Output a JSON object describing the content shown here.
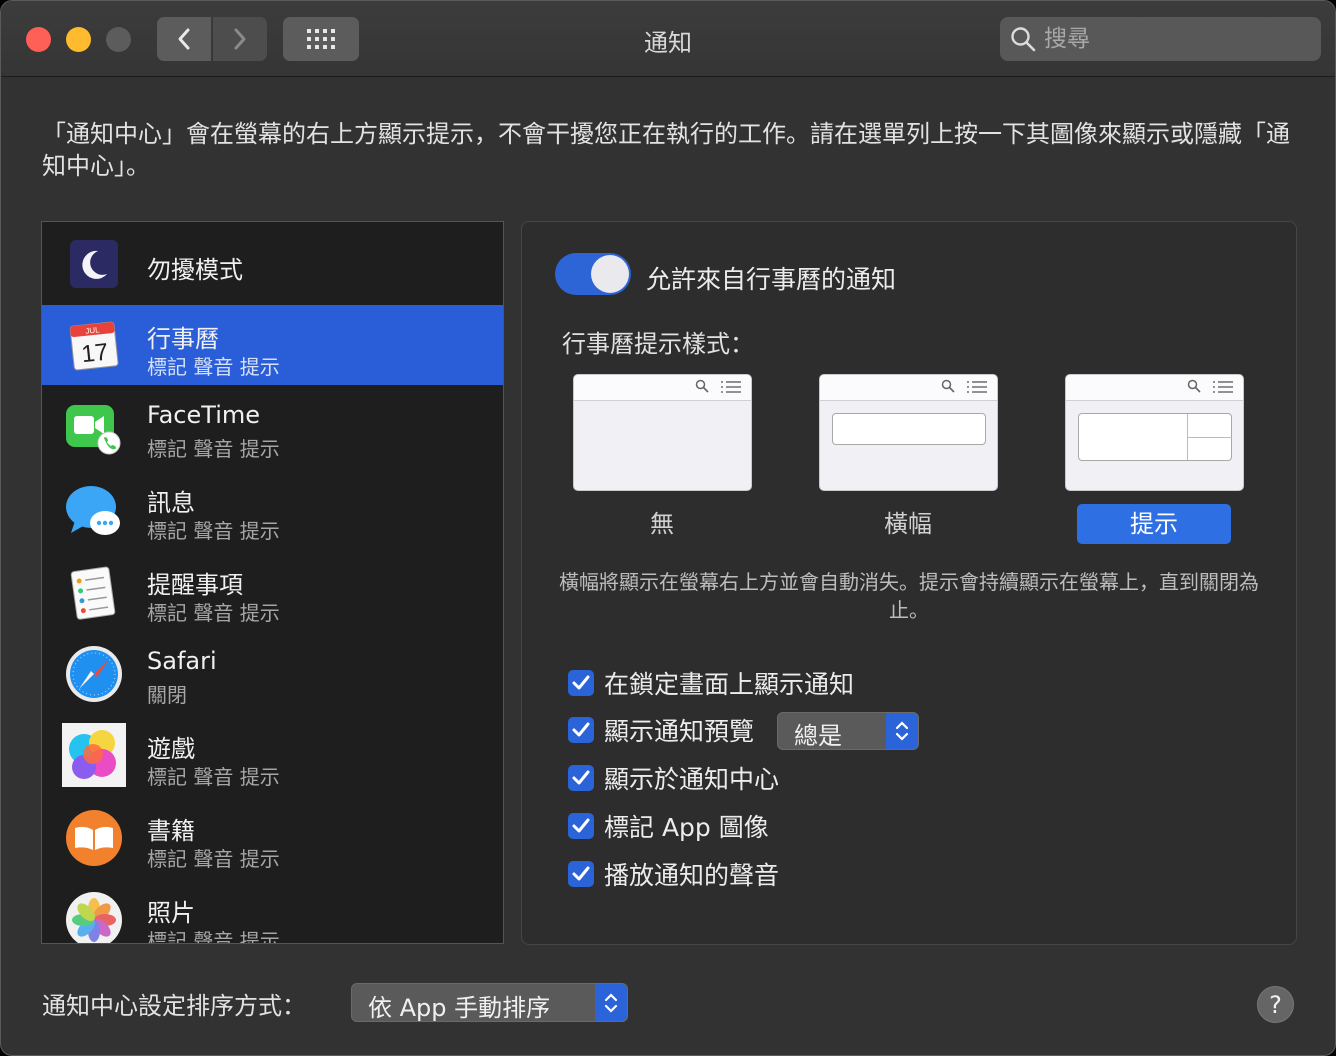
{
  "titlebar": {
    "title": "通知",
    "search_placeholder": "搜尋"
  },
  "description": "「通知中心」會在螢幕的右上方顯示提示，不會干擾您正在執行的工作。請在選單列上按一下其圖像來顯示或隱藏「通知中心」。",
  "apps": [
    {
      "name": "勿擾模式",
      "sub": ""
    },
    {
      "name": "行事曆",
      "sub": "標記 聲音 提示",
      "calendar_month": "JUL",
      "calendar_day": "17"
    },
    {
      "name": "FaceTime",
      "sub": "標記 聲音 提示"
    },
    {
      "name": "訊息",
      "sub": "標記 聲音 提示"
    },
    {
      "name": "提醒事項",
      "sub": "標記 聲音 提示"
    },
    {
      "name": "Safari",
      "sub": "關閉"
    },
    {
      "name": "遊戲",
      "sub": "標記 聲音 提示"
    },
    {
      "name": "書籍",
      "sub": "標記 聲音 提示"
    },
    {
      "name": "照片",
      "sub": "標記 聲音 提示"
    }
  ],
  "selected_app_index": 1,
  "panel": {
    "allow_label": "允許來自行事曆的通知",
    "allow_enabled": true,
    "style_label": "行事曆提示樣式：",
    "styles": [
      {
        "label": "無",
        "selected": false
      },
      {
        "label": "橫幅",
        "selected": false
      },
      {
        "label": "提示",
        "selected": true
      }
    ],
    "note": "橫幅將顯示在螢幕右上方並會自動消失。提示會持續顯示在螢幕上，直到關閉為止。",
    "checks": [
      {
        "label": "在鎖定畫面上顯示通知",
        "checked": true
      },
      {
        "label": "顯示通知預覽",
        "checked": true
      },
      {
        "label": "顯示於通知中心",
        "checked": true
      },
      {
        "label": "標記 App 圖像",
        "checked": true
      },
      {
        "label": "播放通知的聲音",
        "checked": true
      }
    ],
    "preview_select": "總是"
  },
  "footer": {
    "sort_label": "通知中心設定排序方式：",
    "sort_value": "依 App 手動排序",
    "help": "?"
  },
  "colors": {
    "accent": "#2a64d8",
    "selected_row": "#2a5ed8",
    "window_bg": "#323232",
    "list_bg": "#1e1e1e"
  }
}
